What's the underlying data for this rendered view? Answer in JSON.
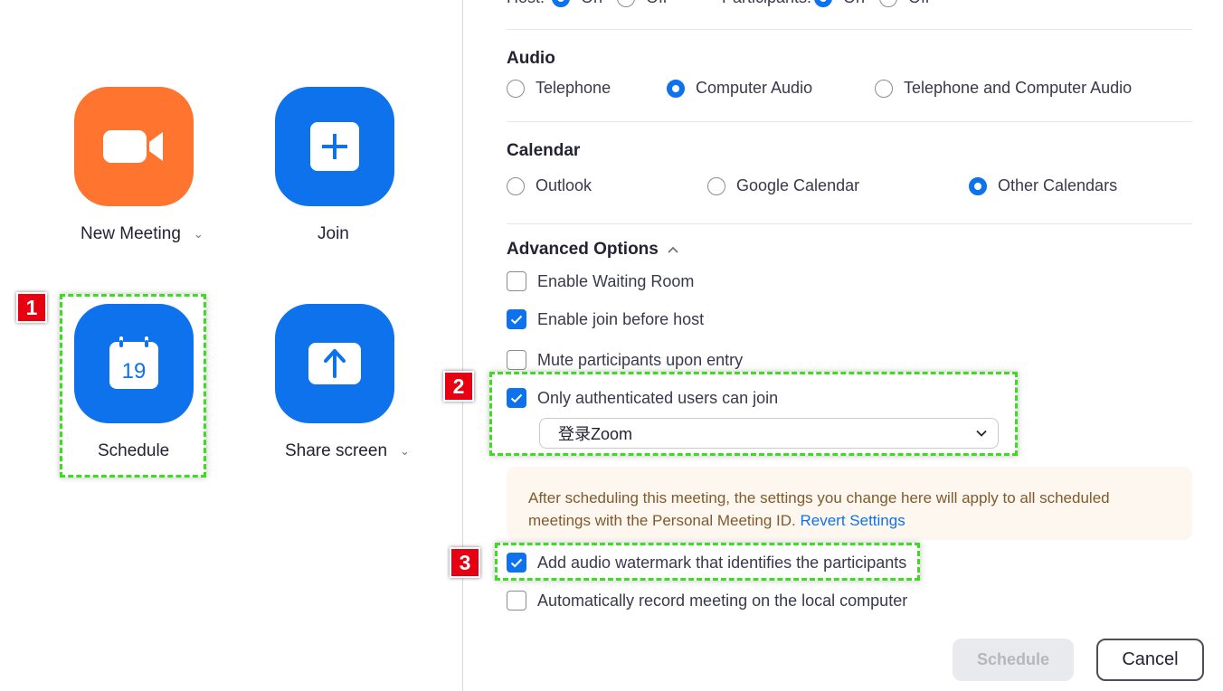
{
  "home": {
    "tiles": [
      {
        "label": "New Meeting",
        "color": "#FF742E",
        "icon": "video-camera-icon",
        "has_dropdown": true
      },
      {
        "label": "Join",
        "color": "#0E72ED",
        "icon": "plus-icon",
        "has_dropdown": false
      },
      {
        "label": "Schedule",
        "color": "#0E72ED",
        "icon": "calendar-icon",
        "icon_text": "19",
        "has_dropdown": false
      },
      {
        "label": "Share screen",
        "color": "#0E72ED",
        "icon": "upload-arrow-icon",
        "has_dropdown": true
      }
    ]
  },
  "schedule": {
    "video_row": {
      "host_label": "Host:",
      "participants_label": "Participants:",
      "on_label": "On",
      "off_label": "Off"
    },
    "audio": {
      "title": "Audio",
      "options": [
        "Telephone",
        "Computer Audio",
        "Telephone and Computer Audio"
      ],
      "selected": "Computer Audio"
    },
    "calendar": {
      "title": "Calendar",
      "options": [
        "Outlook",
        "Google Calendar",
        "Other Calendars"
      ],
      "selected": "Other Calendars"
    },
    "advanced": {
      "title": "Advanced Options",
      "options": [
        {
          "label": "Enable Waiting Room",
          "checked": false
        },
        {
          "label": "Enable join before host",
          "checked": true
        },
        {
          "label": "Mute participants upon entry",
          "checked": false
        },
        {
          "label": "Only authenticated users can join",
          "checked": true
        },
        {
          "label": "Add audio watermark that identifies the participants",
          "checked": true
        },
        {
          "label": "Automatically record meeting on the local computer",
          "checked": false
        }
      ],
      "auth_select_value": "登录Zoom",
      "notice_text": "After scheduling this meeting, the settings you change here will apply to all scheduled meetings with the Personal Meeting ID.",
      "notice_link": "Revert Settings"
    },
    "buttons": {
      "schedule": "Schedule",
      "cancel": "Cancel"
    }
  },
  "annotations": [
    "1",
    "2",
    "3"
  ],
  "colors": {
    "accent": "#0E72ED",
    "orange": "#FF742E",
    "annotation_green": "#3cdc1e",
    "annotation_red": "#E60012",
    "notice_bg": "#FDF7EF"
  }
}
